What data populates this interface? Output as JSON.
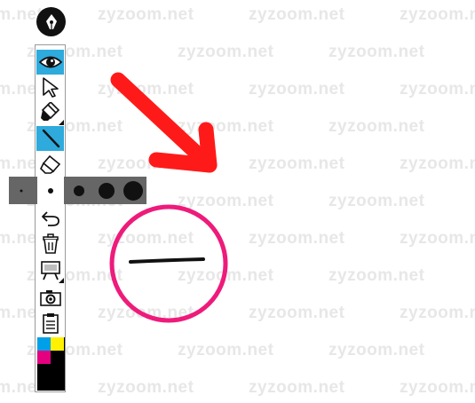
{
  "watermark": {
    "text": "zyzoom.net"
  },
  "toolbar": {
    "logo": {
      "icon": "pen-nib-icon"
    },
    "tools": [
      {
        "name": "view-tool",
        "icon": "eye-icon",
        "active": true
      },
      {
        "name": "select-tool",
        "icon": "cursor-arrow-icon",
        "active": false
      },
      {
        "name": "highlighter-tool",
        "icon": "highlighter-icon",
        "active": false,
        "has_submenu": true
      },
      {
        "name": "pen-tool",
        "icon": "pen-line-icon",
        "active": true
      },
      {
        "name": "eraser-tool",
        "icon": "eraser-icon",
        "active": false
      },
      {
        "name": "undo-tool",
        "icon": "undo-icon",
        "active": false
      },
      {
        "name": "clear-tool",
        "icon": "trash-icon",
        "active": false
      },
      {
        "name": "whiteboard-tool",
        "icon": "easel-icon",
        "active": false,
        "has_submenu": true
      },
      {
        "name": "screenshot-tool",
        "icon": "camera-icon",
        "active": false
      },
      {
        "name": "clipboard-tool",
        "icon": "clipboard-icon",
        "active": false
      }
    ],
    "active_color": "#2eaadc"
  },
  "brush_sizes": {
    "options": [
      1,
      2,
      3,
      4,
      5
    ],
    "selected": 2
  },
  "palette": {
    "colors": [
      "#00a0e9",
      "#fff100",
      "#e4007f",
      "#000000"
    ],
    "background": "#000000"
  },
  "canvas": {
    "arrow_color": "#ff1a1a",
    "circle_color": "#ee1b7b",
    "line_color": "#111111"
  }
}
